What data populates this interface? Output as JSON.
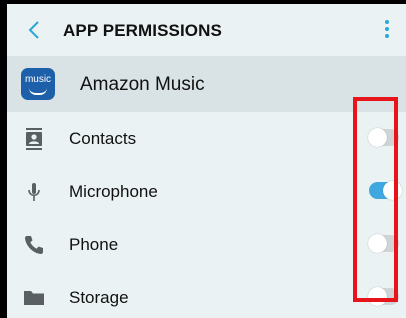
{
  "header": {
    "title": "APP PERMISSIONS",
    "back_icon": "chevron-left-icon",
    "menu_icon": "more-vertical-icon"
  },
  "app": {
    "name": "Amazon Music",
    "icon_text": "music"
  },
  "permissions": [
    {
      "label": "Contacts",
      "icon": "contacts-icon",
      "enabled": false
    },
    {
      "label": "Microphone",
      "icon": "microphone-icon",
      "enabled": true
    },
    {
      "label": "Phone",
      "icon": "phone-icon",
      "enabled": false
    },
    {
      "label": "Storage",
      "icon": "folder-icon",
      "enabled": false
    }
  ],
  "colors": {
    "accent": "#2aa7d6",
    "toggle_on": "#3fa8e0",
    "toggle_off": "#cfd4d6",
    "highlight": "#e8141b",
    "background": "#eaf2f3"
  }
}
